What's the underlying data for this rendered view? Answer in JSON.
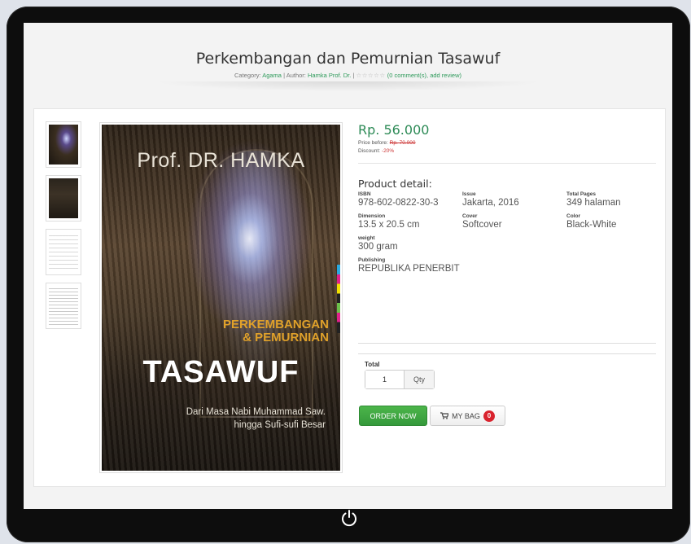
{
  "header": {
    "title": "Perkembangan dan Pemurnian Tasawuf",
    "category_label": "Category:",
    "category": "Agama",
    "author_label": "Author:",
    "author": "Hamka Prof. Dr.",
    "separator": "|",
    "stars": "☆☆☆☆☆",
    "review_link": "(0 comment(s), add review)"
  },
  "cover": {
    "author": "Prof. DR. HAMKA",
    "title_line1": "PERKEMBANGAN",
    "title_line2": "& PEMURNIAN",
    "title_big": "TASAWUF",
    "tagline1": "Dari Masa Nabi Muhammad Saw.",
    "tagline2": "hingga Sufi-sufi Besar"
  },
  "product": {
    "price": "Rp. 56.000",
    "price_before_label": "Price before:",
    "price_before": "Rp. 70.000",
    "discount_label": "Discount:",
    "discount": "-20%",
    "detail_title": "Product detail:",
    "fields": {
      "isbn_label": "ISBN",
      "isbn": "978-602-0822-30-3",
      "issue_label": "Issue",
      "issue": "Jakarta, 2016",
      "pages_label": "Total Pages",
      "pages": "349 halaman",
      "dimension_label": "Dimension",
      "dimension": "13.5 x 20.5 cm",
      "cover_label": "Cover",
      "cover": "Softcover",
      "color_label": "Color",
      "color": "Black-White",
      "weight_label": "weight",
      "weight": "300 gram",
      "publishing_label": "Publishing",
      "publishing": "REPUBLIKA PENERBIT"
    }
  },
  "cart": {
    "total_label": "Total",
    "qty_value": "1",
    "qty_button": "Qty",
    "order_label": "ORDER NOW",
    "bag_label": "MY BAG",
    "bag_count": "0"
  },
  "colors": {
    "accent_green": "#2e8b57",
    "order_button": "#3aa63f",
    "badge": "#d9232e"
  },
  "icons": [
    "power-icon",
    "cart-icon"
  ]
}
